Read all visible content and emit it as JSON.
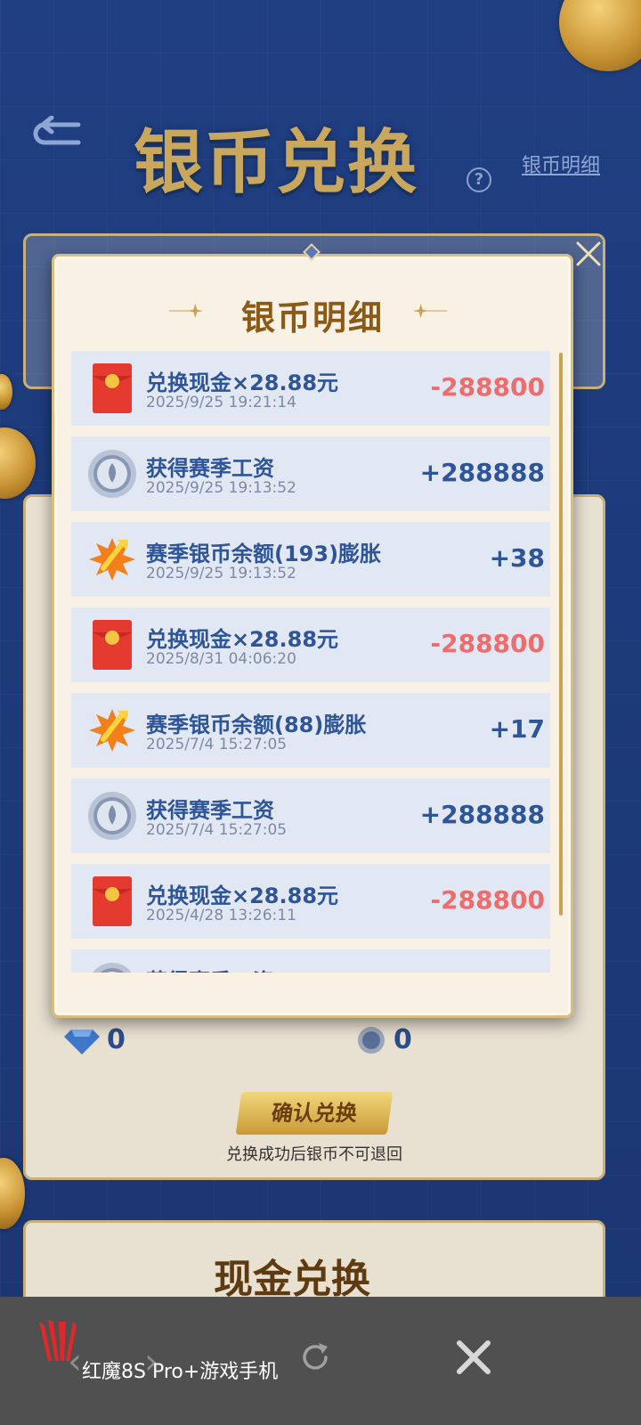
{
  "header": {
    "title": "银币兑换",
    "help": "?",
    "detail_link": "银币明细"
  },
  "modal": {
    "title": "银币明细",
    "items": [
      {
        "icon": "red-envelope-icon",
        "title": "兑换现金×28.88元",
        "time": "2025/9/25 19:21:14",
        "amount": "-288800",
        "sign": "neg"
      },
      {
        "icon": "silver-coin-icon",
        "title": "获得赛季工资",
        "time": "2025/9/25 19:13:52",
        "amount": "+288888",
        "sign": "pos"
      },
      {
        "icon": "inflation-icon",
        "title": "赛季银币余额(193)膨胀",
        "time": "2025/9/25 19:13:52",
        "amount": "+38",
        "sign": "pos"
      },
      {
        "icon": "red-envelope-icon",
        "title": "兑换现金×28.88元",
        "time": "2025/8/31 04:06:20",
        "amount": "-288800",
        "sign": "neg"
      },
      {
        "icon": "inflation-icon",
        "title": "赛季银币余额(88)膨胀",
        "time": "2025/7/4 15:27:05",
        "amount": "+17",
        "sign": "pos"
      },
      {
        "icon": "silver-coin-icon",
        "title": "获得赛季工资",
        "time": "2025/7/4 15:27:05",
        "amount": "+288888",
        "sign": "pos"
      },
      {
        "icon": "red-envelope-icon",
        "title": "兑换现金×28.88元",
        "time": "2025/4/28 13:26:11",
        "amount": "-288800",
        "sign": "neg"
      },
      {
        "icon": "silver-coin-icon",
        "title": "获得赛季工资",
        "time": "",
        "amount": "",
        "sign": "pos"
      }
    ]
  },
  "exchange": {
    "gem_count": "0",
    "coin_count": "0",
    "confirm_label": "确认兑换",
    "confirm_note": "兑换成功后银币不可退回",
    "section_heading": "现金兑换"
  },
  "bottom_bar": {
    "brand": "红魔8S Pro+游戏手机",
    "back": "‹",
    "forward": "›"
  },
  "colors": {
    "background": "#1d3a7a",
    "positive": "#2e5597",
    "negative": "#ef6c6c",
    "gold": "#c9a85e"
  }
}
